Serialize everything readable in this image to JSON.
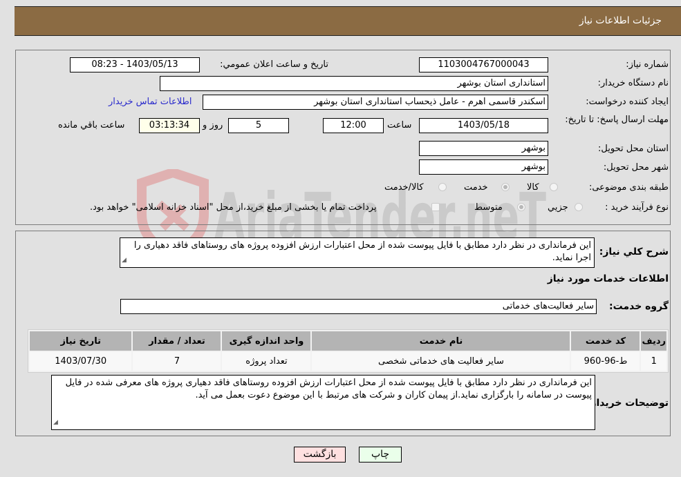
{
  "header": {
    "title": "جزئیات اطلاعات نیاز"
  },
  "watermark": {
    "text": "AriaTender.neT"
  },
  "details": {
    "need_number_label": "شماره نیاز:",
    "need_number": "1103004767000043",
    "announce_label": "تاریخ و ساعت اعلان عمومي:",
    "announce_value": "1403/05/13 - 08:23",
    "buyer_org_label": "نام دستگاه خریدار:",
    "buyer_org": "استانداری استان بوشهر",
    "creator_label": "ایجاد کننده درخواست:",
    "creator": "اسکندر قاسمی اهرم - عامل ذیحساب استانداری استان بوشهر",
    "buyer_contact_link": "اطلاعات تماس خریدار",
    "deadline_label": "مهلت ارسال پاسخ: تا تاریخ:",
    "deadline_date": "1403/05/18",
    "time_label": "ساعت",
    "deadline_time": "12:00",
    "days_value": "5",
    "days_label": "روز و",
    "remaining_time": "03:13:34",
    "remaining_label": "ساعت باقي مانده",
    "province_label": "استان محل تحویل:",
    "province": "بوشهر",
    "city_label": "شهر محل تحویل:",
    "city": "بوشهر",
    "category_label": "طبقه بندی موضوعی:",
    "category_options": [
      {
        "label": "کالا",
        "selected": false
      },
      {
        "label": "خدمت",
        "selected": true
      },
      {
        "label": "کالا/خدمت",
        "selected": false
      }
    ],
    "process_label": "نوع فرآیند خرید :",
    "process_options": [
      {
        "label": "جزيي",
        "selected": false
      },
      {
        "label": "متوسط",
        "selected": true
      }
    ],
    "treasury_checkbox_label": "پرداخت تمام یا بخشی از مبلغ خرید،از محل \"اسناد خزانه اسلامی\" خواهد بود.",
    "treasury_checked": false
  },
  "summary": {
    "label": "شرح کلي نیاز:",
    "text": "این فرمانداری در نظر دارد مطابق با فایل پیوست شده از محل اعتبارات ارزش افزوده پروژه های روستاهای فاقد دهیاری را اجرا نماید."
  },
  "services": {
    "section_title": "اطلاعات خدمات مورد نیاز",
    "group_label": "گروه خدمت:",
    "group_value": "سایر فعالیت‌های خدماتی",
    "table": {
      "headers": [
        "ردیف",
        "کد خدمت",
        "نام خدمت",
        "واحد اندازه گیری",
        "تعداد / مقدار",
        "تاریخ نیاز"
      ],
      "rows": [
        [
          "1",
          "ط-96-960",
          "سایر فعالیت های خدماتی شخصی",
          "تعداد پروژه",
          "7",
          "1403/07/30"
        ]
      ]
    }
  },
  "buyer_notes": {
    "label": "توضیحات خریدار:",
    "text": "این فرمانداری در نظر دارد مطابق با فایل پیوست شده از محل اعتبارات ارزش افزوده روستاهای فاقد دهیاری پروژه های معرفی شده در فایل پیوست در سامانه را بارگزاری نماید.از پیمان کاران و شرکت های مرتبط با این موضوع دعوت بعمل می آید."
  },
  "buttons": {
    "print": "چاپ",
    "back": "بازگشت"
  },
  "colors": {
    "header_bg": "#8b6b43",
    "print_bg": "#eaffea",
    "back_bg": "#ffe0e0",
    "link": "#2a2acc"
  }
}
